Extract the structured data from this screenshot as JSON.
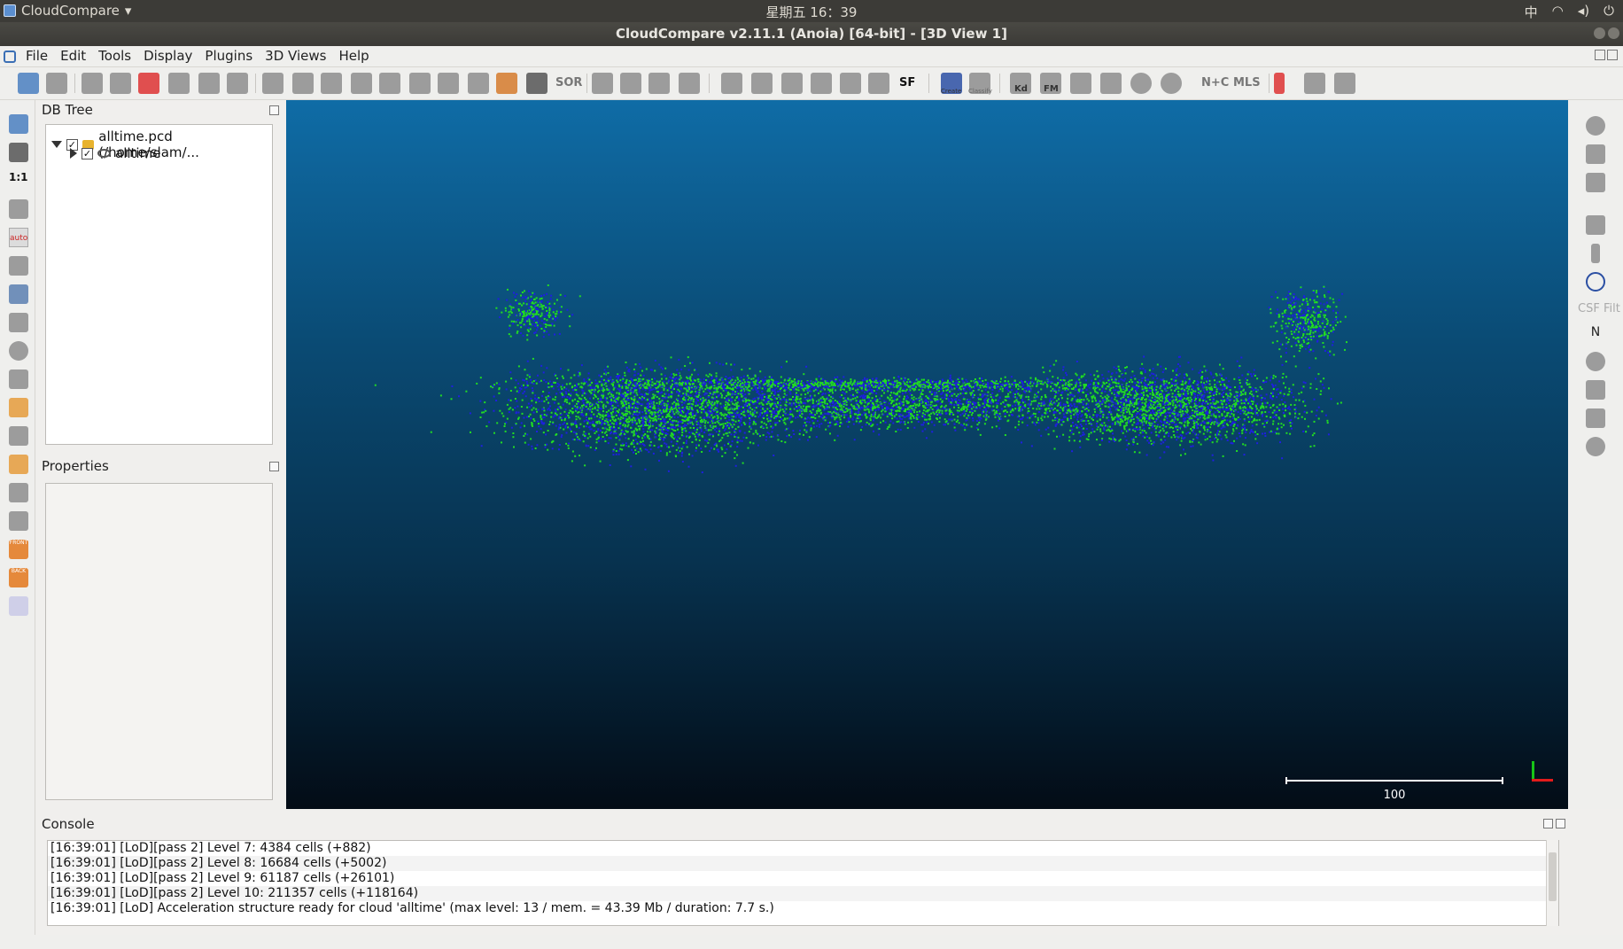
{
  "os_topbar": {
    "app_name": "CloudCompare",
    "clock": "星期五 16：39",
    "input_method": "中"
  },
  "window": {
    "title": "CloudCompare v2.11.1 (Anoia) [64-bit] - [3D View 1]"
  },
  "menu": {
    "items": [
      "File",
      "Edit",
      "Tools",
      "Display",
      "Plugins",
      "3D Views",
      "Help"
    ]
  },
  "toolbar": {
    "sor_label": "SOR",
    "sf_label": "SF",
    "canupo_create": "Create",
    "canupo_classify": "Classify",
    "kd_label": "Kd",
    "fm_label": "FM",
    "n_c_label": "N+C",
    "mls_label": "MLS"
  },
  "left_toolbar": {
    "scale_1_1": "1:1",
    "auto_label": "auto",
    "front_label": "FRONT",
    "back_label": "BACK"
  },
  "db_tree": {
    "title": "DB Tree",
    "root": {
      "label": "alltime.pcd (/home/slam/...",
      "checked": true,
      "expanded": true
    },
    "child": {
      "label": "alltime",
      "checked": true,
      "expanded": false
    }
  },
  "properties": {
    "title": "Properties"
  },
  "view3d": {
    "scale_value": "100",
    "background_top": "#0f6ca6",
    "background_bottom": "#030c16",
    "cloud_colors": [
      "#1f1fe0",
      "#22dd22"
    ]
  },
  "right_toolbar": {
    "csf_label": "CSF Filt",
    "n_label": "N"
  },
  "console": {
    "title": "Console",
    "lines": [
      "[16:39:01] [LoD][pass 2] Level 7: 4384 cells (+882)",
      "[16:39:01] [LoD][pass 2] Level 8: 16684 cells (+5002)",
      "[16:39:01] [LoD][pass 2] Level 9: 61187 cells (+26101)",
      "[16:39:01] [LoD][pass 2] Level 10: 211357 cells (+118164)",
      "[16:39:01] [LoD] Acceleration structure ready for cloud 'alltime' (max level: 13 / mem. = 43.39 Mb / duration: 7.7 s.)"
    ]
  }
}
